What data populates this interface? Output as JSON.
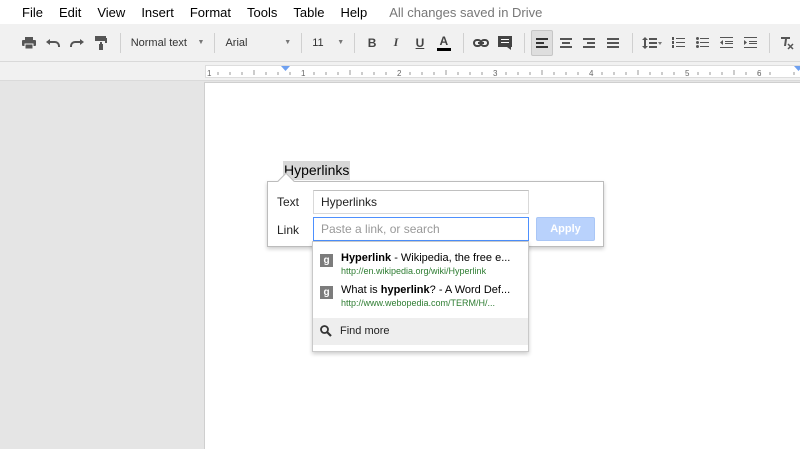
{
  "menu": [
    "File",
    "Edit",
    "View",
    "Insert",
    "Format",
    "Tools",
    "Table",
    "Help"
  ],
  "save_status": "All changes saved in Drive",
  "toolbar": {
    "style": "Normal text",
    "font": "Arial",
    "size": "11",
    "bold": "B",
    "italic": "I",
    "underline": "U",
    "text_color": "A"
  },
  "ruler": {
    "numbers": [
      "1",
      "1",
      "2",
      "3",
      "4",
      "5",
      "6"
    ]
  },
  "document": {
    "selected_text": "Hyperlinks"
  },
  "link_dialog": {
    "text_label": "Text",
    "text_value": "Hyperlinks",
    "link_label": "Link",
    "link_placeholder": "Paste a link, or search",
    "apply_label": "Apply"
  },
  "suggestions": [
    {
      "icon": "g",
      "title_bold": "Hyperlink",
      "title_rest": " - Wikipedia, the free e...",
      "url": "http://en.wikipedia.org/wiki/Hyperlink"
    },
    {
      "icon": "g",
      "title_pre": "What is ",
      "title_bold": "hyperlink",
      "title_rest": "? - A Word Def...",
      "url": "http://www.webopedia.com/TERM/H/..."
    }
  ],
  "find_more_label": "Find more",
  "colors": {
    "accent_blue": "#4d90fe",
    "apply_disabled": "#b9d2fc",
    "url_green": "#2e7d32",
    "selection_gray": "#d8d8d8"
  }
}
